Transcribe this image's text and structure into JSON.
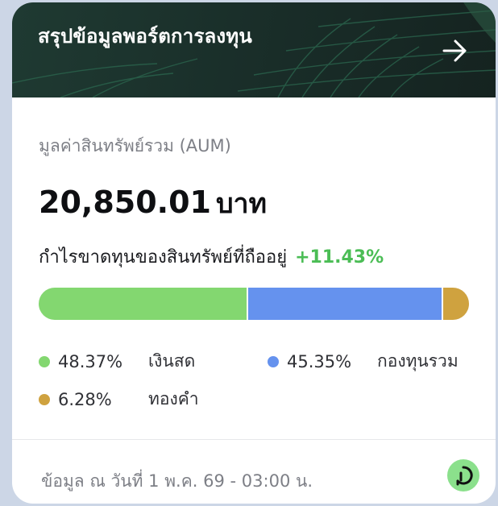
{
  "header": {
    "title": "สรุปข้อมูลพอร์ตการลงทุน",
    "arrow_icon": "arrow-right-icon"
  },
  "aum": {
    "label": "มูลค่าสินทรัพย์รวม (AUM)",
    "value": "20,850.01",
    "unit": "บาท"
  },
  "profit_loss": {
    "label": "กำไรขาดทุนของสินทรัพย์ที่ถืออยู่",
    "value": "+11.43%",
    "color": "#4bbd55"
  },
  "allocation": [
    {
      "percent": "48.37%",
      "fraction": 48.37,
      "name": "เงินสด",
      "color": "#83d770"
    },
    {
      "percent": "45.35%",
      "fraction": 45.35,
      "name": "กองทุนรวม",
      "color": "#6592ee"
    },
    {
      "percent": "6.28%",
      "fraction": 6.28,
      "name": "ทองคำ",
      "color": "#cfa23f"
    }
  ],
  "footer": {
    "updated_text": "ข้อมูล ณ วันที่ 1 พ.ค. 69 - 03:00 น.",
    "logo_icon": "dime-logo-icon"
  }
}
